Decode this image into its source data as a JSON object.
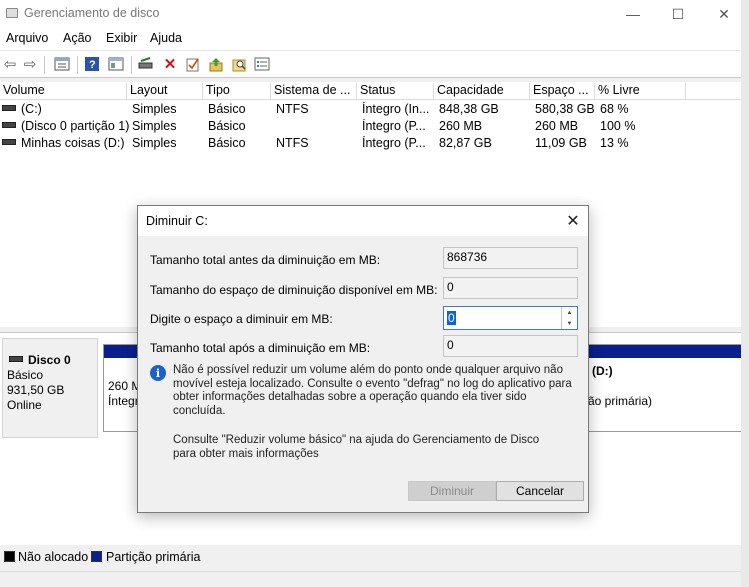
{
  "window": {
    "title": "Gerenciamento de disco",
    "minimize_icon": "—",
    "maximize_icon": "☐",
    "close_icon": "✕"
  },
  "menu": [
    "Arquivo",
    "Ação",
    "Exibir",
    "Ajuda"
  ],
  "toolbar_icons": [
    "back-arrow-icon",
    "forward-arrow-icon",
    "properties-icon",
    "help-icon",
    "console-view-icon",
    "connect-drive-icon",
    "delete-icon",
    "check-icon",
    "export-icon",
    "search-icon",
    "settings-list-icon"
  ],
  "volume_table": {
    "columns": [
      "Volume",
      "Layout",
      "Tipo",
      "Sistema de ...",
      "Status",
      "Capacidade",
      "Espaço ...",
      "% Livre"
    ],
    "rows": [
      {
        "volume": "(C:)",
        "layout": "Simples",
        "tipo": "Básico",
        "sistema": "NTFS",
        "status": "Íntegro (In...",
        "capacidade": "848,38 GB",
        "espaco": "580,38 GB",
        "livre": "68 %"
      },
      {
        "volume": "(Disco 0 partição 1)",
        "layout": "Simples",
        "tipo": "Básico",
        "sistema": "",
        "status": "Íntegro (P...",
        "capacidade": "260 MB",
        "espaco": "260 MB",
        "livre": "100 %"
      },
      {
        "volume": "Minhas coisas (D:)",
        "layout": "Simples",
        "tipo": "Básico",
        "sistema": "NTFS",
        "status": "Íntegro (P...",
        "capacidade": "82,87 GB",
        "espaco": "11,09 GB",
        "livre": "13 %"
      }
    ]
  },
  "disk": {
    "name": "Disco 0",
    "type": "Básico",
    "size": "931,50 GB",
    "state": "Online",
    "partA_line1": "260 M",
    "partA_line2": "Íntegr",
    "partB_line1": "(D:)",
    "partB_line2": "ão primária)"
  },
  "legend": {
    "unallocated": "Não alocado",
    "primary": "Partição primária",
    "unallocated_color": "#000000",
    "primary_color": "#0b1f8f"
  },
  "dialog": {
    "title": "Diminuir C:",
    "fields": [
      {
        "label": "Tamanho total antes da diminuição em MB:",
        "value": "868736"
      },
      {
        "label": "Tamanho do espaço de diminuição disponível em MB:",
        "value": "0"
      },
      {
        "label": "Digite o espaço a diminuir em MB:",
        "value": "0"
      },
      {
        "label": "Tamanho total após a diminuição em MB:",
        "value": "0"
      }
    ],
    "info_text": "Não é possível reduzir um volume além do ponto onde qualquer arquivo não movível esteja localizado. Consulte o evento \"defrag\" no log do aplicativo para obter informações detalhadas sobre a operação quando ela tiver sido concluída.",
    "help_text": "Consulte \"Reduzir volume básico\" na ajuda do Gerenciamento de Disco para obter mais informações",
    "shrink_button": "Diminuir",
    "cancel_button": "Cancelar"
  }
}
